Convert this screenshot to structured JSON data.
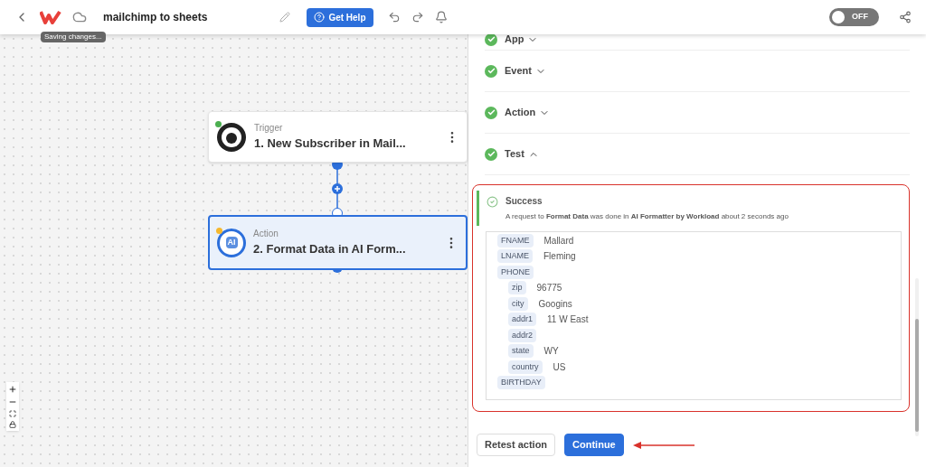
{
  "header": {
    "title": "mailchimp to sheets",
    "tooltip": "Saving changes...",
    "help_button": "Get Help",
    "toggle": {
      "label": "OFF",
      "on": false
    }
  },
  "canvas": {
    "nodes": [
      {
        "kind": "trigger",
        "type_label": "Trigger",
        "title": "1. New Subscriber in Mail...",
        "selected": false,
        "color": "#4caf50"
      },
      {
        "kind": "action",
        "type_label": "Action",
        "title": "2. Format Data in AI Form...",
        "selected": true,
        "color": "#f5b82e",
        "icon_text": "AI"
      }
    ]
  },
  "panel": {
    "sections": [
      {
        "label": "App",
        "expanded": false,
        "done": true
      },
      {
        "label": "Event",
        "expanded": false,
        "done": true
      },
      {
        "label": "Action",
        "expanded": false,
        "done": true
      },
      {
        "label": "Test",
        "expanded": true,
        "done": true
      }
    ],
    "result": {
      "status": "Success",
      "message": "A request to **Format Data** was done in **AI Formatter by Workload** about 2 seconds ago",
      "fields": [
        {
          "key": "FNAME",
          "value": "Mallard"
        },
        {
          "key": "LNAME",
          "value": "Fleming"
        },
        {
          "key": "PHONE",
          "children": [
            {
              "key": "zip",
              "value": "96775"
            },
            {
              "key": "city",
              "value": "Googins"
            },
            {
              "key": "addr1",
              "value": "11 W East"
            },
            {
              "key": "addr2"
            },
            {
              "key": "state",
              "value": "WY"
            },
            {
              "key": "country",
              "value": "US"
            }
          ]
        },
        {
          "key": "BIRTHDAY"
        }
      ]
    },
    "buttons": [
      {
        "label": "Retest action",
        "kind": "secondary"
      },
      {
        "label": "Continue",
        "kind": "primary"
      }
    ]
  }
}
